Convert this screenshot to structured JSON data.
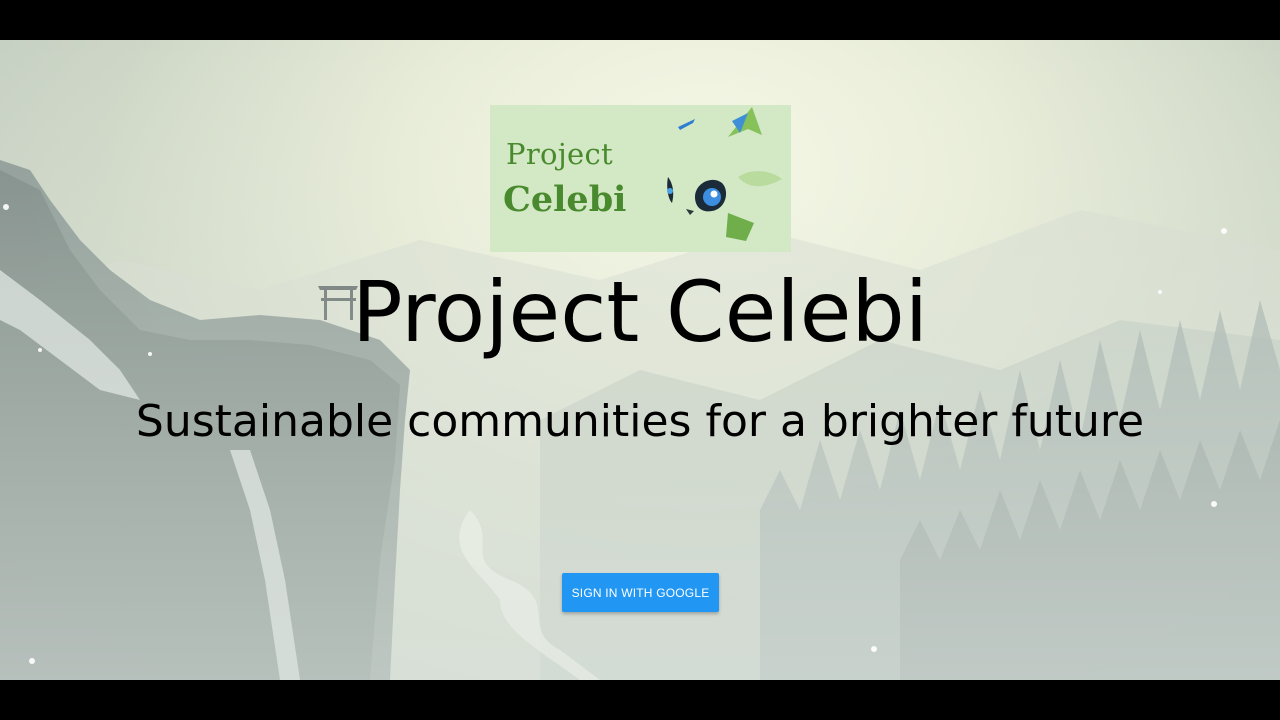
{
  "logo": {
    "line1": "Project",
    "line2": "Celebi",
    "bg_color": "#d3e8c4",
    "text_color": "#4a8a2e"
  },
  "hero": {
    "title": "Project Celebi",
    "subtitle": "Sustainable communities for a brighter future"
  },
  "actions": {
    "signin_label": "SIGN IN WITH GOOGLE",
    "signin_color": "#2196f3"
  }
}
